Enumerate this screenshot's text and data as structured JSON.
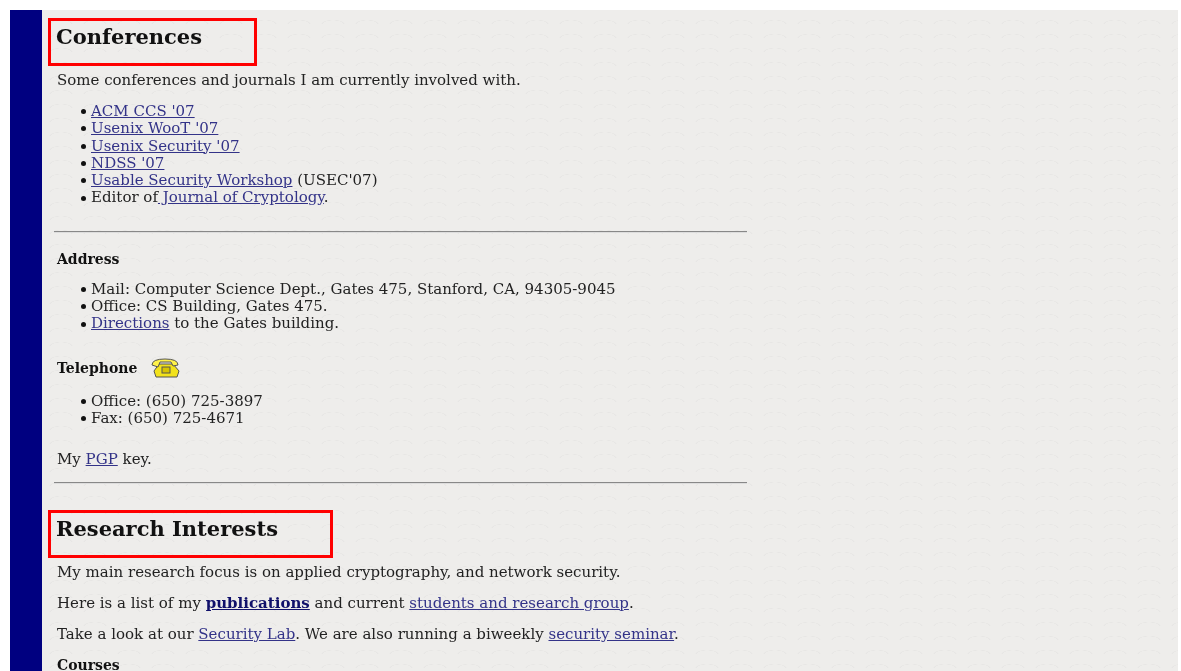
{
  "sections": [
    {
      "kind": "heading",
      "text": "Conferences",
      "highlighted": true
    },
    {
      "kind": "paragraph",
      "segments": [
        {
          "kind": "text",
          "text": "Some conferences and journals I am currently involved with."
        }
      ]
    },
    {
      "kind": "list",
      "items": [
        {
          "segments": [
            {
              "kind": "link",
              "text": "ACM CCS '07"
            }
          ]
        },
        {
          "segments": [
            {
              "kind": "link",
              "text": "Usenix WooT '07"
            }
          ]
        },
        {
          "segments": [
            {
              "kind": "link",
              "text": "Usenix Security '07"
            }
          ]
        },
        {
          "segments": [
            {
              "kind": "link",
              "text": "NDSS '07"
            }
          ]
        },
        {
          "segments": [
            {
              "kind": "link",
              "text": "Usable Security Workshop"
            },
            {
              "kind": "text",
              "text": " (USEC'07)"
            }
          ]
        },
        {
          "segments": [
            {
              "kind": "text",
              "text": "Editor of"
            },
            {
              "kind": "link",
              "text": " Journal of Cryptology"
            },
            {
              "kind": "text",
              "text": "."
            }
          ]
        }
      ]
    },
    {
      "kind": "rule"
    },
    {
      "kind": "subheading",
      "text": "Address",
      "phone_icon": false
    },
    {
      "kind": "list",
      "items": [
        {
          "segments": [
            {
              "kind": "text",
              "text": "Mail: Computer Science Dept., Gates 475, Stanford, CA, 94305-9045"
            }
          ]
        },
        {
          "segments": [
            {
              "kind": "text",
              "text": "Office: CS Building, Gates 475."
            }
          ]
        },
        {
          "segments": [
            {
              "kind": "link",
              "text": "Directions"
            },
            {
              "kind": "text",
              "text": " to the Gates building."
            }
          ]
        }
      ]
    },
    {
      "kind": "subheading",
      "text": "Telephone",
      "phone_icon": true
    },
    {
      "kind": "list",
      "items": [
        {
          "segments": [
            {
              "kind": "text",
              "text": "Office: (650) 725-3897"
            }
          ]
        },
        {
          "segments": [
            {
              "kind": "text",
              "text": "Fax: (650) 725-4671"
            }
          ]
        }
      ]
    },
    {
      "kind": "paragraph",
      "segments": [
        {
          "kind": "text",
          "text": "My "
        },
        {
          "kind": "link",
          "text": "PGP"
        },
        {
          "kind": "text",
          "text": " key."
        }
      ]
    },
    {
      "kind": "rule"
    },
    {
      "kind": "heading",
      "text": "Research Interests",
      "highlighted": true
    },
    {
      "kind": "paragraph",
      "segments": [
        {
          "kind": "text",
          "text": "My main research focus is on applied cryptography, and network security."
        }
      ]
    },
    {
      "kind": "paragraph",
      "segments": [
        {
          "kind": "text",
          "text": "Here is a list of my "
        },
        {
          "kind": "bold-link",
          "text": "publications"
        },
        {
          "kind": "text",
          "text": " and current "
        },
        {
          "kind": "link",
          "text": "students and research group"
        },
        {
          "kind": "text",
          "text": "."
        }
      ]
    },
    {
      "kind": "paragraph",
      "segments": [
        {
          "kind": "text",
          "text": "Take a look at our "
        },
        {
          "kind": "link",
          "text": "Security Lab"
        },
        {
          "kind": "text",
          "text": ". We are also running a biweekly "
        },
        {
          "kind": "link",
          "text": "security seminar"
        },
        {
          "kind": "text",
          "text": "."
        }
      ]
    },
    {
      "kind": "subheading",
      "text": "Courses",
      "phone_icon": false
    }
  ]
}
